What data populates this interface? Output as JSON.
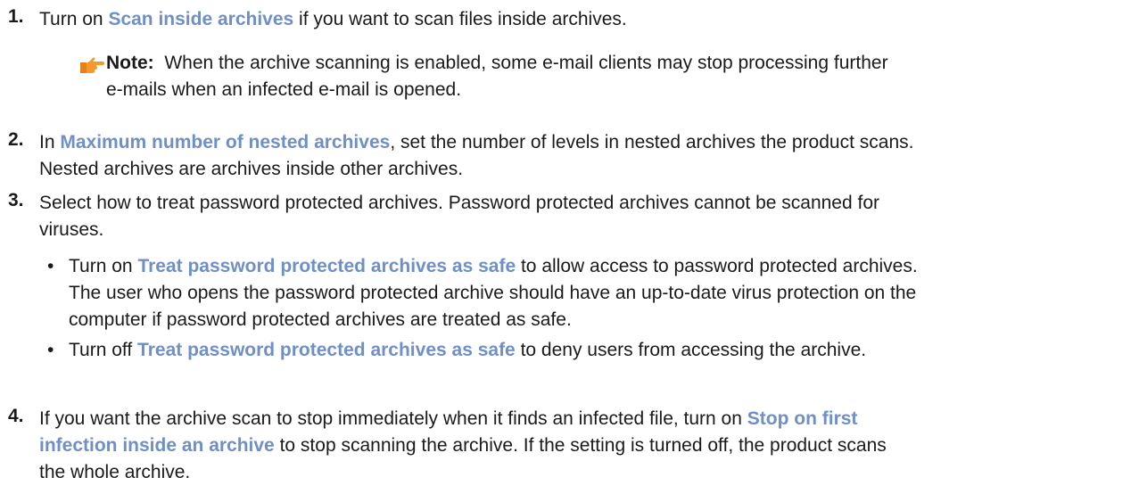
{
  "steps": [
    {
      "number": "1.",
      "before": "Turn on ",
      "ui": "Scan inside archives",
      "after": " if you want to scan files inside archives."
    },
    {
      "number": "2.",
      "before": "In ",
      "ui": "Maximum number of nested archives",
      "after": ", set the number of levels in nested archives the product scans.",
      "line2": "Nested archives are archives inside other archives."
    },
    {
      "number": "3.",
      "line1": "Select how to treat password protected archives. Password protected archives cannot be scanned for",
      "line2": "viruses.",
      "bullets": [
        {
          "dot": "•",
          "before": "Turn on ",
          "ui": "Treat password protected archives as safe",
          "after": " to allow access to password protected archives.",
          "line2": "The user who opens the password protected archive should have an up-to-date virus protection on the",
          "line3": "computer if password protected archives are treated as safe."
        },
        {
          "dot": "•",
          "before": "Turn off ",
          "ui": "Treat password protected archives as safe",
          "after": " to deny users from accessing the archive."
        }
      ]
    },
    {
      "number": "4.",
      "before": "If you want the archive scan to stop immediately when it finds an infected file, turn on ",
      "ui_a": "Stop on first",
      "ui_b": "infection inside an archive",
      "after": " to stop scanning the archive. If the setting is turned off, the product scans",
      "line3": "the whole archive."
    }
  ],
  "note": {
    "label": "Note:",
    "line1": "When the archive scanning is enabled, some e-mail clients may stop processing further",
    "line2": "e-mails when an infected e-mail is opened.",
    "icon": "pointing-hand-icon"
  },
  "colors": {
    "ui_term": "#6f8fc7",
    "text": "#1a1a1a",
    "icon": "#e8801a"
  }
}
